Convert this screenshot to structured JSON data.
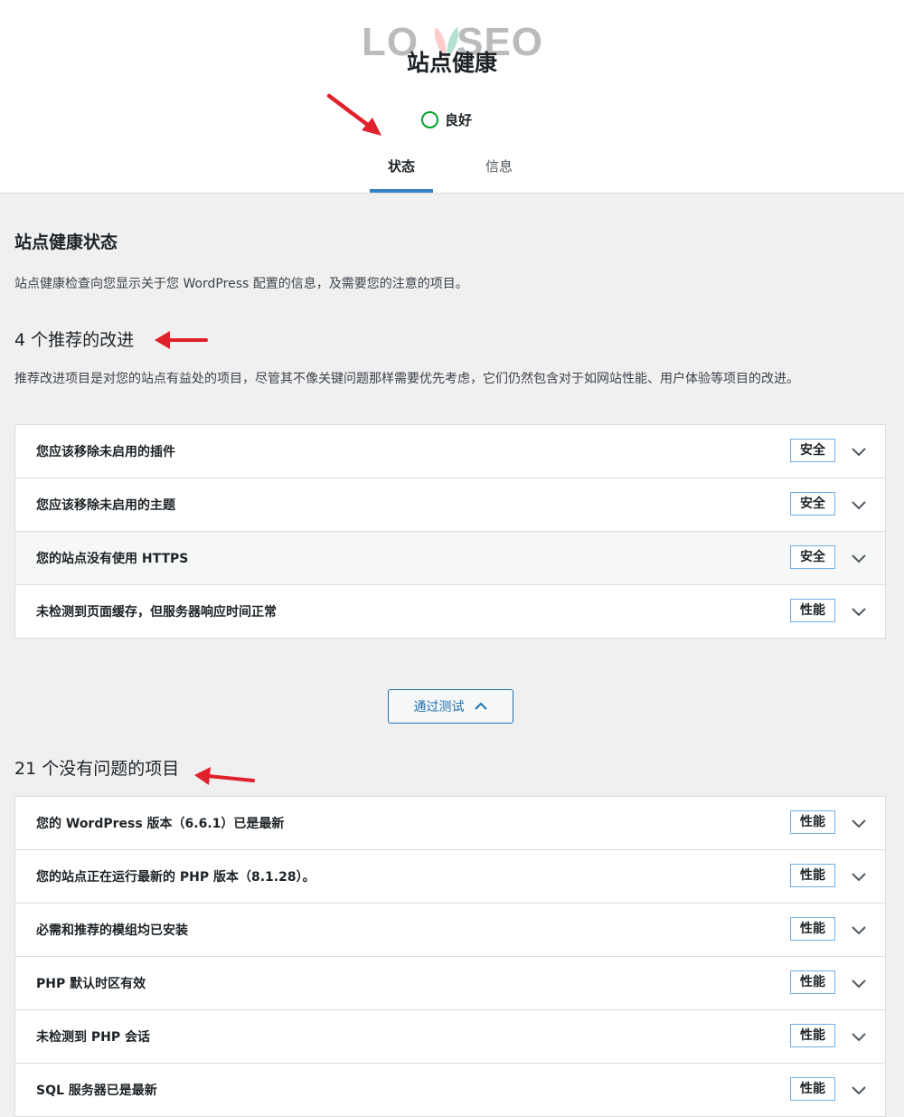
{
  "watermark": {
    "left": "LO",
    "right": "SEO"
  },
  "header": {
    "title": "站点健康",
    "status": "良好",
    "tabs": [
      {
        "label": "状态",
        "active": true
      },
      {
        "label": "信息",
        "active": false
      }
    ]
  },
  "status_section": {
    "title": "站点健康状态",
    "description": "站点健康检查向您显示关于您 WordPress 配置的信息，及需要您的注意的项目。"
  },
  "recommended": {
    "heading": "4 个推荐的改进",
    "description": "推荐改进项目是对您的站点有益处的项目，尽管其不像关键问题那样需要优先考虑，它们仍然包含对于如网站性能、用户体验等项目的改进。",
    "items": [
      {
        "label": "您应该移除未启用的插件",
        "badge": "安全"
      },
      {
        "label": "您应该移除未启用的主题",
        "badge": "安全"
      },
      {
        "label": "您的站点没有使用 HTTPS",
        "badge": "安全"
      },
      {
        "label": "未检测到页面缓存，但服务器响应时间正常",
        "badge": "性能"
      }
    ]
  },
  "passed_button": {
    "label": "通过测试"
  },
  "passed": {
    "heading": "21 个没有问题的项目",
    "items": [
      {
        "label": "您的 WordPress 版本（6.6.1）已是最新",
        "badge": "性能"
      },
      {
        "label": "您的站点正在运行最新的 PHP 版本（8.1.28）。",
        "badge": "性能"
      },
      {
        "label": "必需和推荐的模组均已安装",
        "badge": "性能"
      },
      {
        "label": "PHP 默认时区有效",
        "badge": "性能"
      },
      {
        "label": "未检测到 PHP 会话",
        "badge": "性能"
      },
      {
        "label": "SQL 服务器已是最新",
        "badge": "性能"
      }
    ]
  },
  "colors": {
    "accent": "#2271b1",
    "good": "#00a32a",
    "arrow": "#e0202a"
  }
}
